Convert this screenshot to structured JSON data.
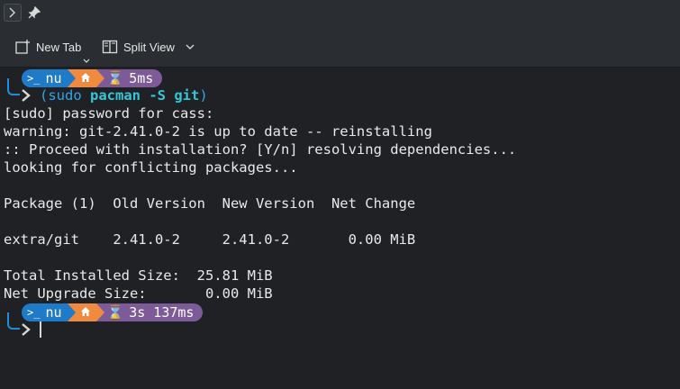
{
  "toolbar": {
    "new_tab_label": "New Tab",
    "split_view_label": "Split View"
  },
  "prompt1": {
    "shell": "nu",
    "duration": "5ms"
  },
  "command": {
    "open": "(",
    "sudo": "sudo ",
    "program": "pacman",
    "args": " -S git",
    "close": ")"
  },
  "output": [
    "[sudo] password for cass:",
    "warning: git-2.41.0-2 is up to date -- reinstalling",
    ":: Proceed with installation? [Y/n] resolving dependencies...",
    "looking for conflicting packages...",
    "",
    "Package (1)  Old Version  New Version  Net Change",
    "",
    "extra/git    2.41.0-2     2.41.0-2       0.00 MiB",
    "",
    "Total Installed Size:  25.81 MiB",
    "Net Upgrade Size:       0.00 MiB"
  ],
  "prompt2": {
    "shell": "nu",
    "duration": "3s 137ms"
  },
  "colors": {
    "nu_segment": "#1f7bc7",
    "home_segment": "#f08a3e",
    "duration_segment": "#7d5b98",
    "command_accent": "#34c6d8"
  }
}
